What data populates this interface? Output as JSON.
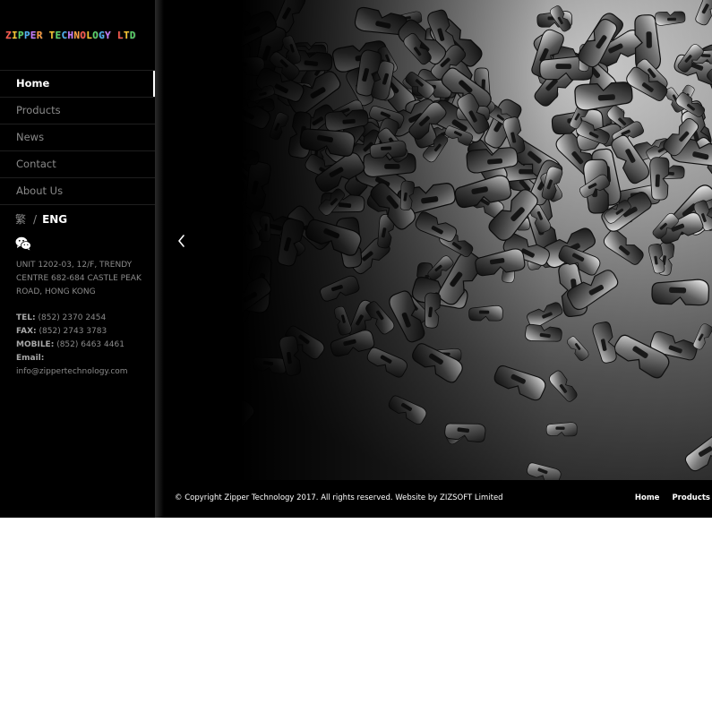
{
  "brand": {
    "logo_text": "ZIPPER TECHNOLOGY LTD"
  },
  "nav": {
    "items": [
      {
        "label": "Home",
        "active": true
      },
      {
        "label": "Products",
        "active": false
      },
      {
        "label": "News",
        "active": false
      },
      {
        "label": "Contact",
        "active": false
      },
      {
        "label": "About Us",
        "active": false
      }
    ]
  },
  "language": {
    "traditional": "繁",
    "separator": "/",
    "english": "ENG"
  },
  "contact": {
    "wechat_icon": "wechat-icon",
    "address": "UNIT 1202-03, 12/F, TRENDY CENTRE 682-684 CASTLE PEAK ROAD, HONG KONG",
    "tel_label": "TEL:",
    "tel": "(852) 2370 2454",
    "fax_label": "FAX:",
    "fax": "(852) 2743 3783",
    "mobile_label": "MOBILE:",
    "mobile": "(852) 6463 4461",
    "email_label": "Email:",
    "email": "info@zippertechnology.com"
  },
  "slider": {
    "prev_icon": "chevron-left-icon"
  },
  "footer": {
    "copyright": "© Copyright Zipper Technology 2017. All rights reserved. Website by ZIZSOFT Limited",
    "links": [
      "Home",
      "Products"
    ]
  },
  "colors": {
    "background": "#000000",
    "nav_text": "#8a8a8a",
    "active_text": "#ffffff"
  }
}
